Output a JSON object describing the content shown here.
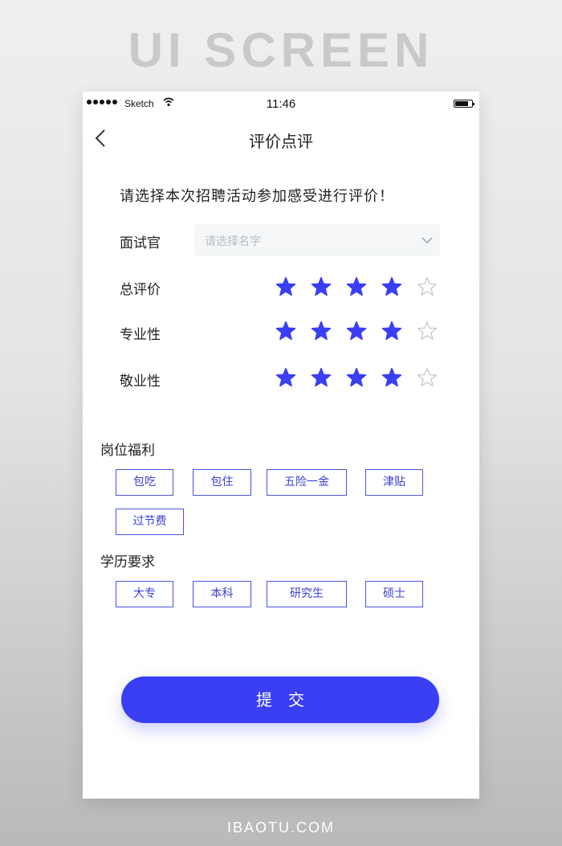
{
  "banner": "UI SCREEN",
  "footer": "IBAOTU.COM",
  "status_bar": {
    "carrier": "Sketch",
    "time": "11:46"
  },
  "nav": {
    "title": "评价点评",
    "back_icon": "chevron-left-icon"
  },
  "prompt": "请选择本次招聘活动参加感受进行评价！",
  "interviewer": {
    "label": "面试官",
    "placeholder": "请选择名字",
    "dropdown_icon": "chevron-down-icon"
  },
  "ratings": [
    {
      "label": "总评价",
      "value": 4,
      "max": 5
    },
    {
      "label": "专业性",
      "value": 4,
      "max": 5
    },
    {
      "label": "敬业性",
      "value": 4,
      "max": 5
    }
  ],
  "benefits": {
    "title": "岗位福利",
    "tags": [
      "包吃",
      "包住",
      "五险一金",
      "津贴",
      "过节费"
    ]
  },
  "education": {
    "title": "学历要求",
    "tags": [
      "大专",
      "本科",
      "研究生",
      "硕士"
    ]
  },
  "submit_label": "提交",
  "colors": {
    "accent": "#3a3ff4",
    "star_filled": "#3a3ff4",
    "star_empty": "#c8c8c8",
    "tag_border": "#4c54e0"
  }
}
